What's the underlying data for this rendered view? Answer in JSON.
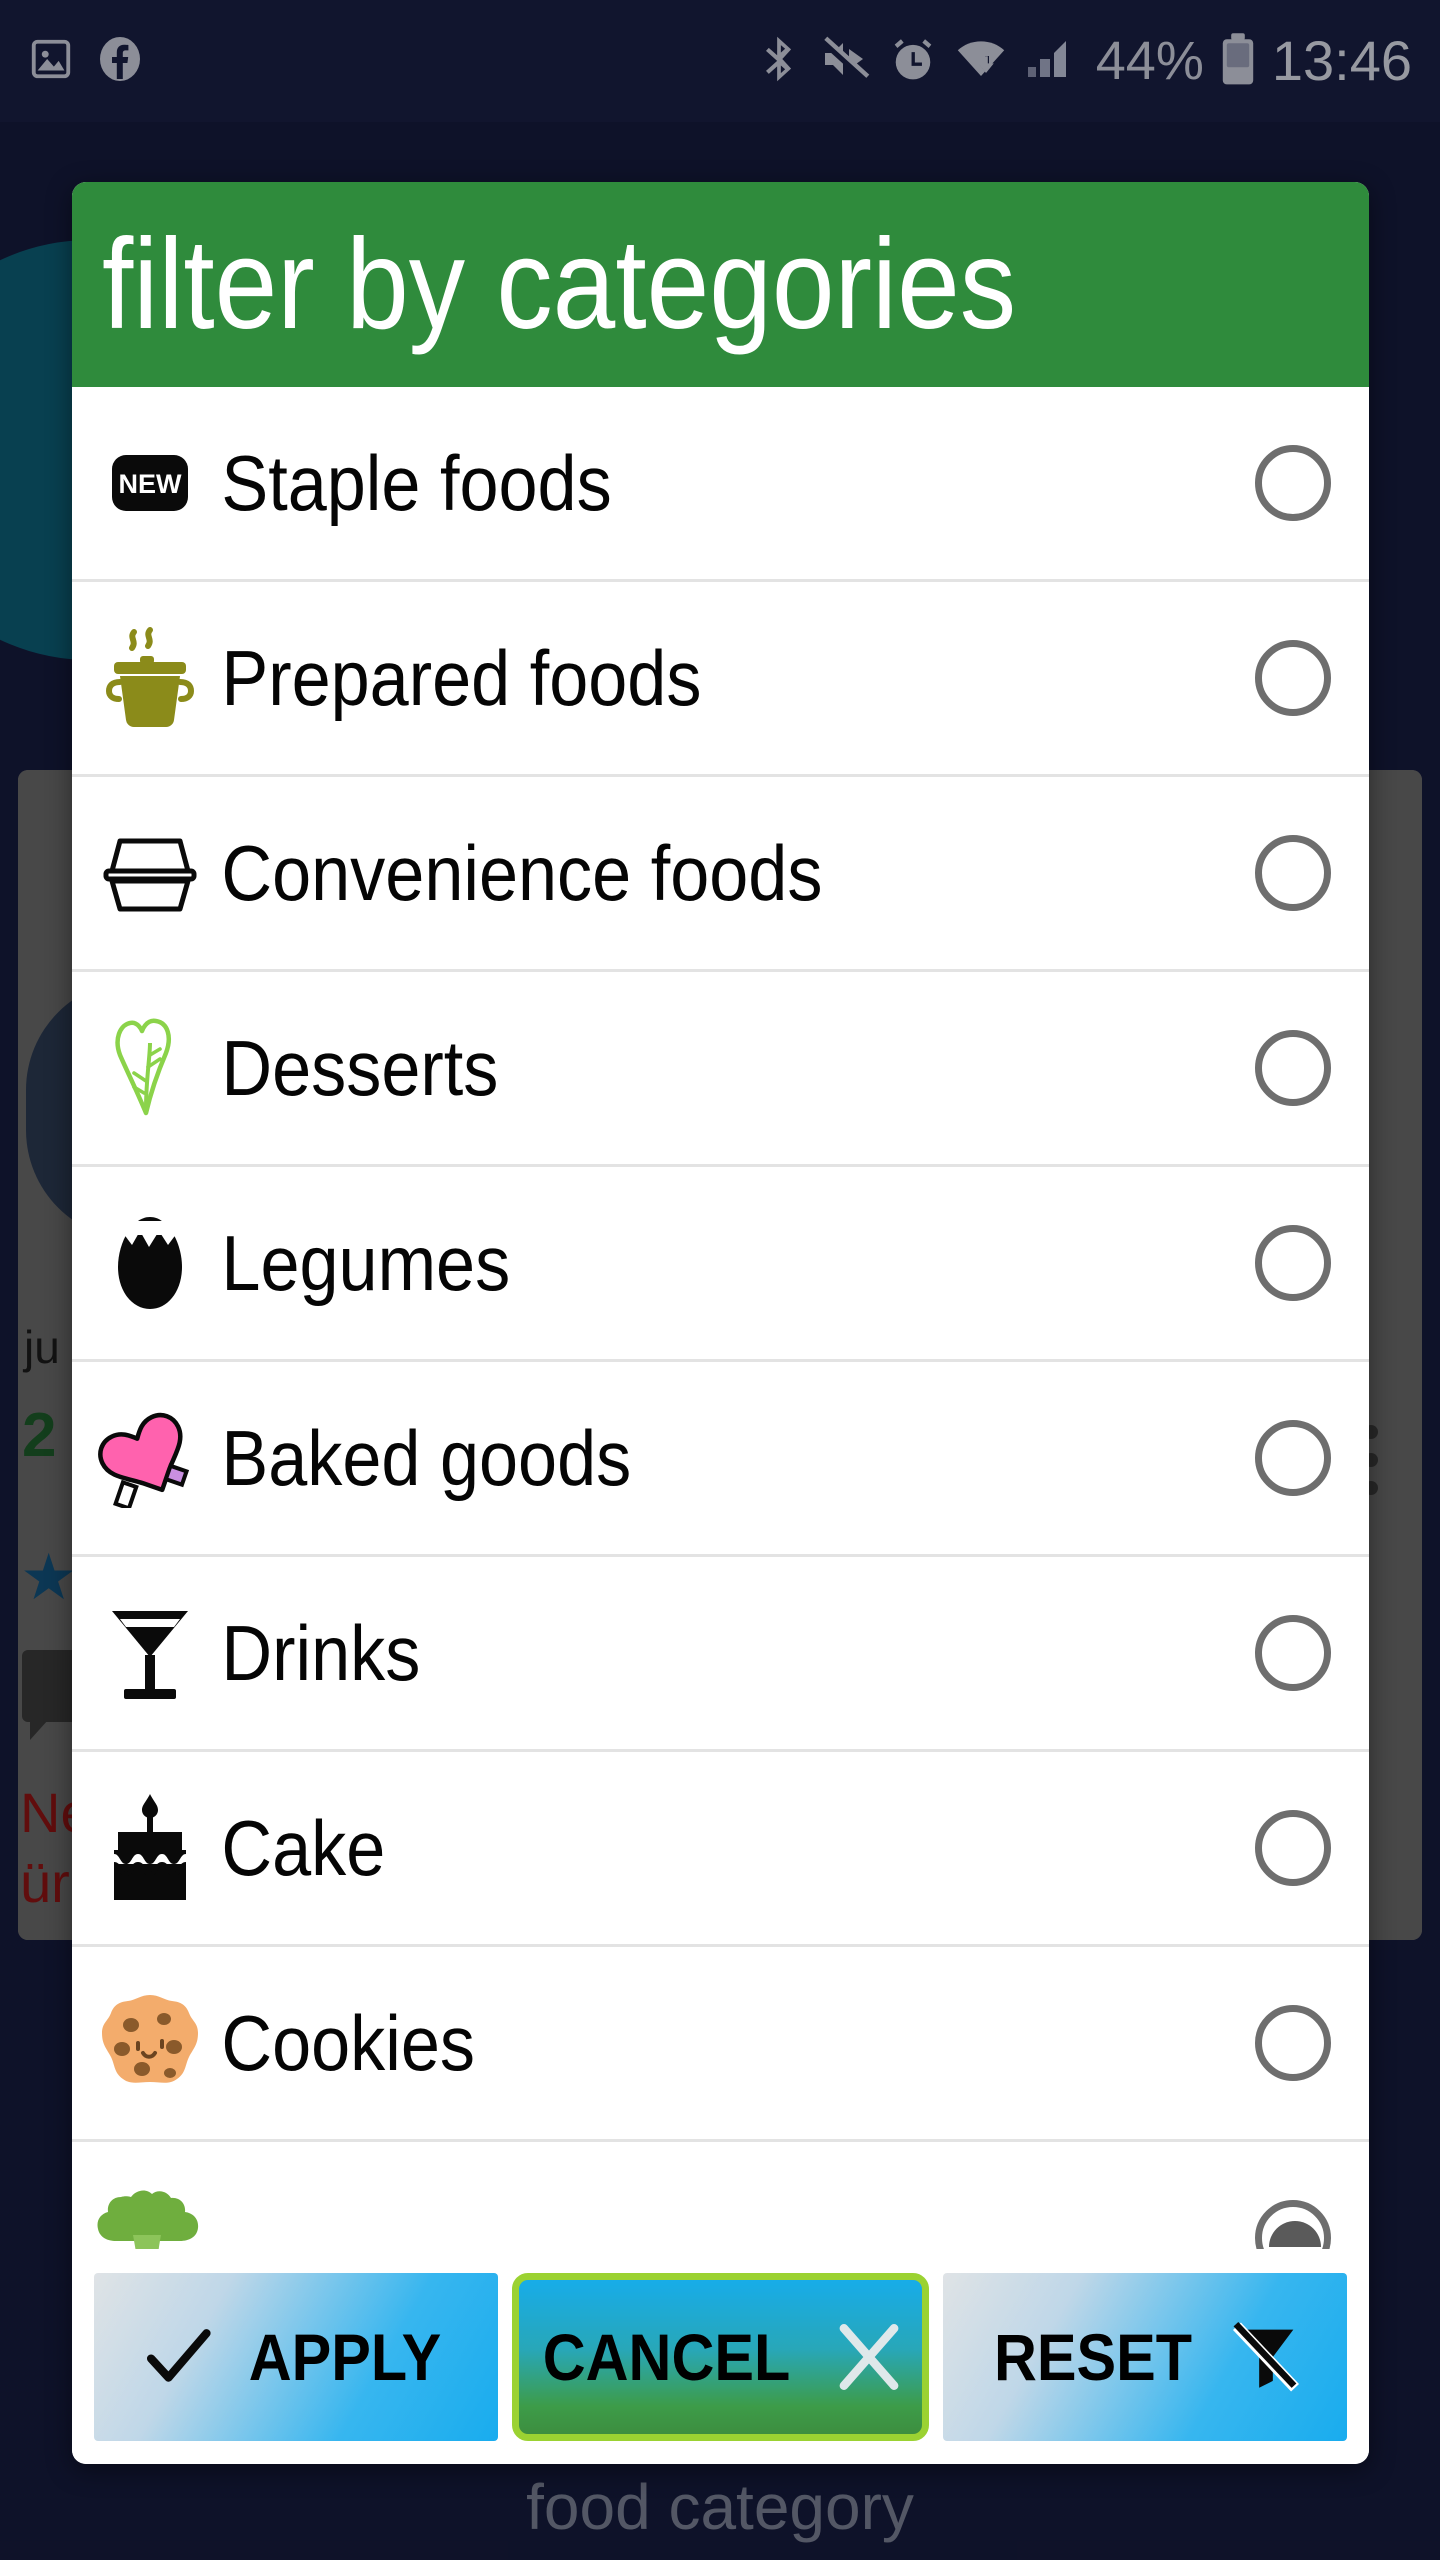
{
  "statusbar": {
    "left_icons": [
      "image-icon",
      "facebook-icon"
    ],
    "right_icons": [
      "bluetooth-icon",
      "volume-mute-icon",
      "alarm-icon",
      "wifi-icon",
      "cellular-signal-icon",
      "battery-icon"
    ],
    "battery_percent": "44%",
    "time": "13:46"
  },
  "background": {
    "text_ju": "ju",
    "text_count": "2",
    "star_glyph": "★",
    "text_ne": "Ne",
    "text_ur": "ür",
    "footer_label": "food category"
  },
  "dialog": {
    "title": "filter by categories",
    "title_bg": "#2f8b3c",
    "items": [
      {
        "label": "Staple foods",
        "icon": "new-badge-icon",
        "selected": false
      },
      {
        "label": "Prepared foods",
        "icon": "cooking-pot-icon",
        "selected": false
      },
      {
        "label": "Convenience foods",
        "icon": "takeout-container-icon",
        "selected": false
      },
      {
        "label": "Desserts",
        "icon": "leafy-green-icon",
        "selected": false
      },
      {
        "label": "Legumes",
        "icon": "cracked-egg-icon",
        "selected": false
      },
      {
        "label": "Baked goods",
        "icon": "oven-mitt-icon",
        "selected": false
      },
      {
        "label": "Drinks",
        "icon": "cocktail-glass-icon",
        "selected": false
      },
      {
        "label": "Cake",
        "icon": "birthday-cake-icon",
        "selected": false
      },
      {
        "label": "Cookies",
        "icon": "cookie-icon",
        "selected": false
      },
      {
        "label": "",
        "icon": "broccoli-icon",
        "selected": false
      }
    ],
    "buttons": [
      {
        "label": "APPLY",
        "icon": "checkmark-icon",
        "focused": false
      },
      {
        "label": "CANCEL",
        "icon": "close-x-icon",
        "focused": true
      },
      {
        "label": "RESET",
        "icon": "filter-off-icon",
        "focused": false
      }
    ]
  },
  "colors": {
    "accent_green": "#2f8b3c",
    "focus_border": "#9bd232",
    "button_blue": "#19acee",
    "status_bar_bg": "#1a1f45",
    "radio_stroke": "#6e6e6e"
  }
}
